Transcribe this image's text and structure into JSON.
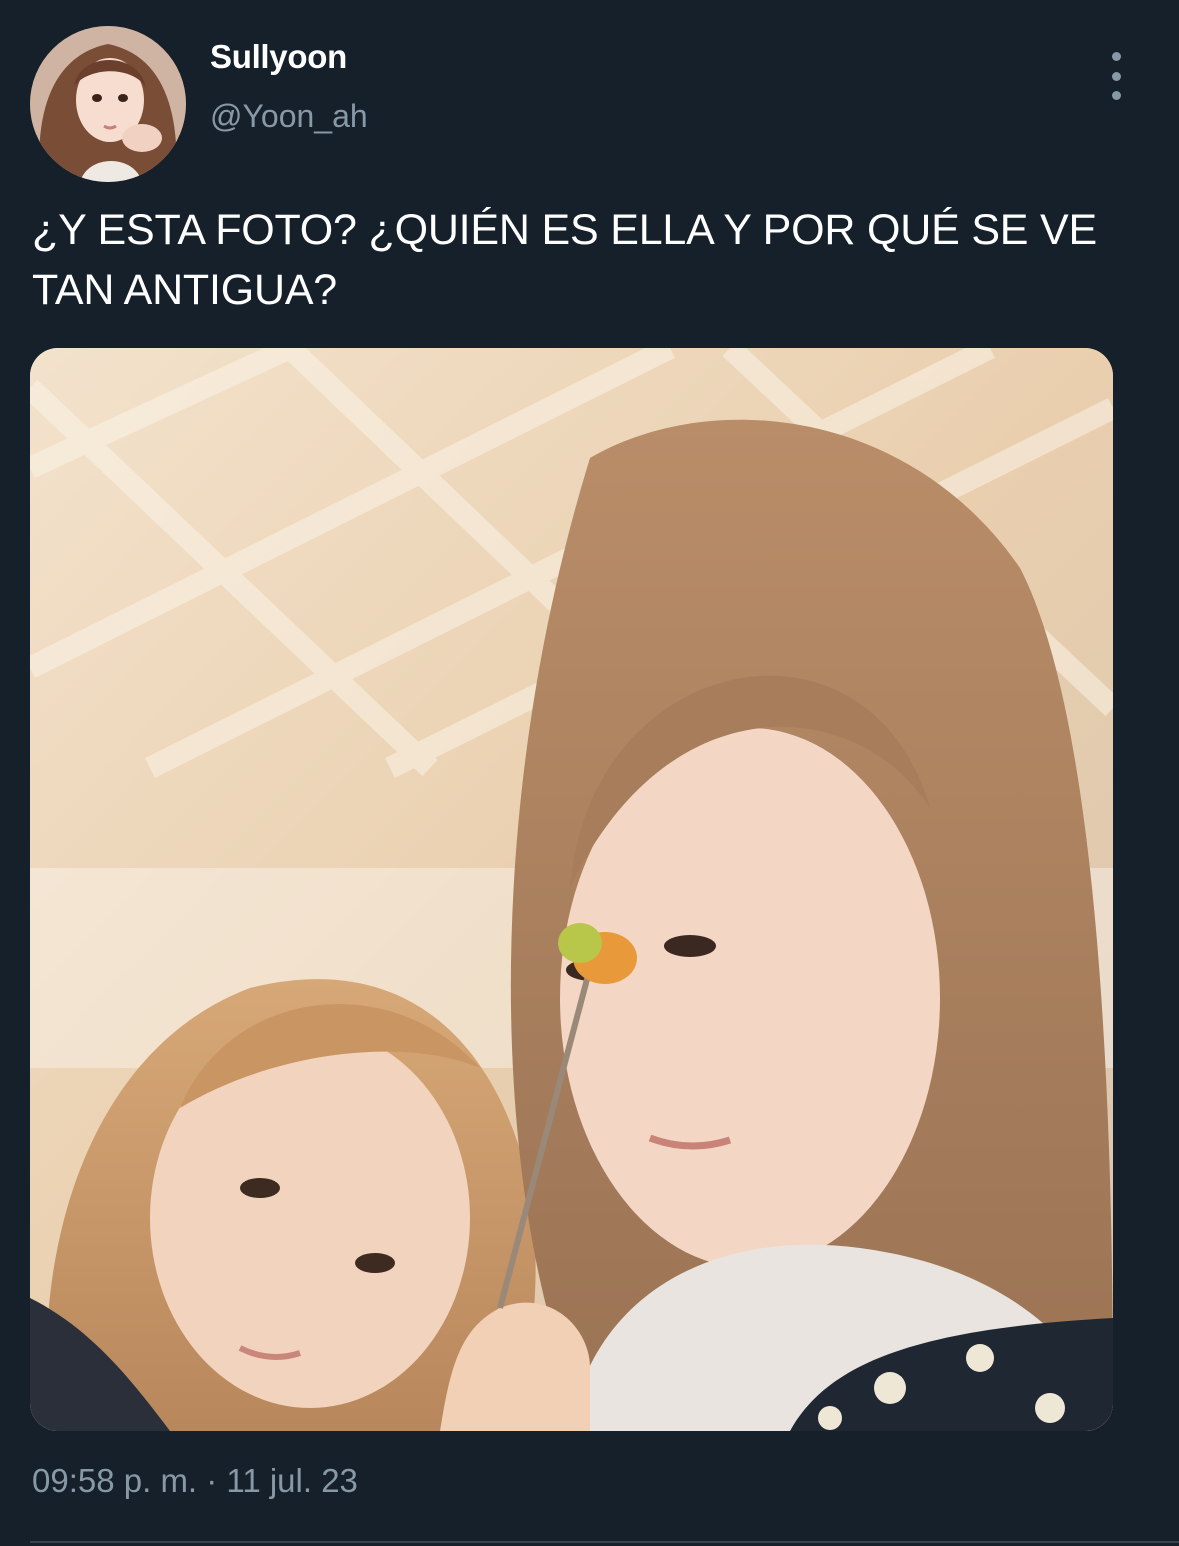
{
  "tweet": {
    "author": {
      "display_name": "Sullyoon",
      "handle": "@Yoon_ah",
      "avatar_icon": "profile-photo-avatar"
    },
    "more_icon": "more-vertical-icon",
    "text": "¿Y ESTA FOTO? ¿QUIÉN ES ELLA Y POR QUÉ SE VE TAN ANTIGUA?",
    "media": {
      "type": "photo"
    },
    "timestamp": "09:58 p. m. · 11 jul. 23"
  },
  "colors": {
    "background": "#15202b",
    "text_primary": "#ffffff",
    "text_secondary": "#8899a6",
    "divider": "#38444d"
  }
}
